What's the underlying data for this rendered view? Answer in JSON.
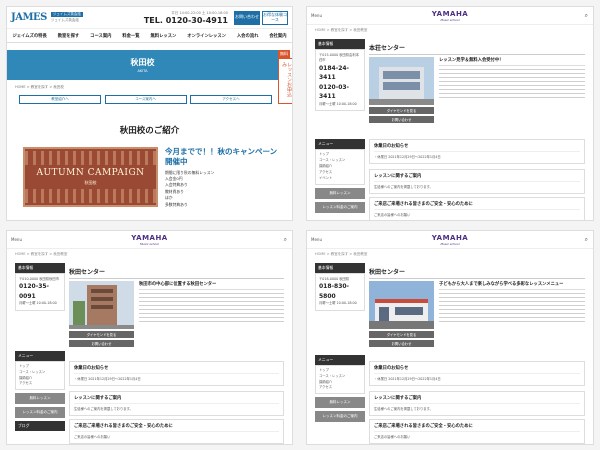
{
  "p1": {
    "logo": "JAMES",
    "tag1": "ジェイムズ英会話",
    "tag2": "ジェイムズ英会話",
    "hours": "平日 14:00-22:00 土 10:00-18:00",
    "tel": "TEL. 0120-30-4911",
    "btn1": "お問い合わせ",
    "btn2": "お得な体験コース",
    "nav": [
      "ジェイムズの特長",
      "教室を探す",
      "コース案内",
      "料金一覧",
      "無料レッスン",
      "オンラインレッスン",
      "入会の流れ",
      "会社案内"
    ],
    "banner_title": "秋田校",
    "banner_sub": "AKITA",
    "side_top": "無料",
    "side_body": "レッスンお申込み",
    "crumb": "HOME > 教室を探す > 秋田校",
    "sub_links": [
      "教室紹介へ",
      "コース案内へ",
      "アクセスへ"
    ],
    "intro_title": "秋田校のご紹介",
    "camp_line1": "AUTUMN CAMPAIGN",
    "camp_line2": "秋田校",
    "promo_title": "今月までで！！秋のキャンペーン開催中",
    "promo_items": [
      "期間に限り秋の無料レッスン",
      "入会金0円",
      "入会特典あり",
      "教材費あり",
      "ほか",
      "多数特典あり"
    ]
  },
  "yamaha": {
    "menu": "Menu",
    "mark": "YAMAHA",
    "sub": "Music school",
    "crumb": "HOME > 教室を探す > 秋田教室"
  },
  "p2": {
    "title": "本荘センター",
    "side_head": "基本情報",
    "addr": "〒015-0000 秋田県由利本荘市",
    "phone1": "0184-24-3411",
    "phone2": "0120-03-3411",
    "hours": "月曜〜土曜 10:00-18:00",
    "btn_map": "ダイヤモンドを見る",
    "btn_contact": "お問い合わせ",
    "intro_title": "レッスン見学＆無料入会受付中！",
    "box1_title": "休業日のお知らせ",
    "box1_line": "・休業日 2021年12月29日～2022年1月4日",
    "box2_title": "レッスンに関するご案内",
    "box2_line": "生徒様へのご案内を掲載しております。",
    "box3_title": "ご来店ご来場される皆さまのご安全・安心のために",
    "box3_line": "ご来店の皆様へのお願い"
  },
  "p3": {
    "title": "秋田センター",
    "side_head": "基本情報",
    "addr": "〒010-0000 秋田県秋田市",
    "phone1": "0120-35-0091",
    "hours": "月曜〜土曜 10:00-18:00",
    "btn_map": "ダイヤモンドを見る",
    "btn_contact": "お問い合わせ",
    "intro_title": "秋田市の中心部に位置する秋田センター",
    "box1_title": "休業日のお知らせ",
    "box1_line": "・休業日 2021年12月29日～2022年1月4日",
    "box2_title": "レッスンに関するご案内",
    "box2_line": "生徒様へのご案内を掲載しております。",
    "box3_title": "ご来店ご来場される皆さまのご安全・安心のために",
    "box3_line": "ご来店の皆様へのお願い",
    "blog": "ブログ"
  },
  "p4": {
    "title": "秋田センター",
    "side_head": "基本情報",
    "addr": "〒018-0000 秋田県",
    "phone1": "018-830-5800",
    "hours": "月曜〜土曜 10:00-18:00",
    "btn_map": "ダイヤモンドを見る",
    "btn_contact": "お問い合わせ",
    "intro_title": "子どもから大人まで楽しみながら学べる多彩なレッスンメニュー",
    "box1_title": "休業日のお知らせ",
    "box1_line": "・休業日 2021年12月29日～2022年1月4日",
    "box2_title": "レッスンに関するご案内",
    "box2_line": "生徒様へのご案内を掲載しております。",
    "box3_title": "ご来店ご来場される皆さまのご安全・安心のために",
    "box3_line": "ご来店の皆様へのお願い"
  },
  "side_menu": {
    "head": "メニュー",
    "items": [
      "トップ",
      "コース・レッスン",
      "講師紹介",
      "アクセス",
      "イベント",
      "お知らせ"
    ],
    "btn1": "無料レッスン",
    "btn2": "レッスン料金のご案内"
  },
  "colors": {
    "james_blue": "#1d6fa5",
    "yamaha_purple": "#4b2e83",
    "accent_orange": "#d9542b"
  }
}
